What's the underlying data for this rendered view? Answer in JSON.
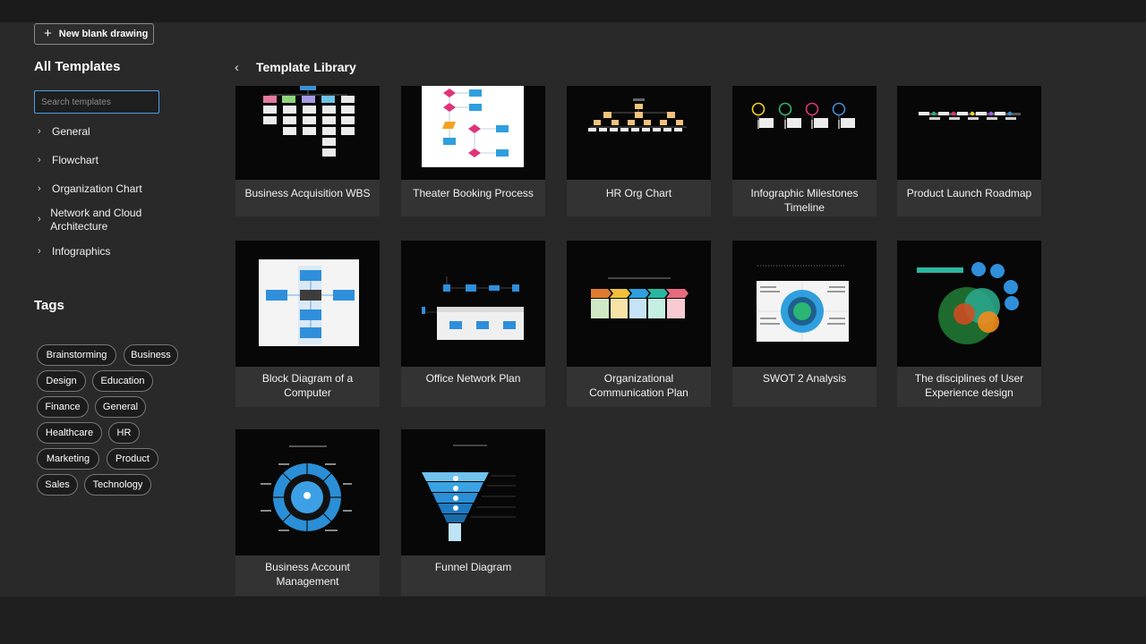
{
  "toolbar": {
    "new_blank_label": "New blank drawing"
  },
  "sidebar": {
    "title": "All Templates",
    "search_placeholder": "Search templates",
    "categories": [
      {
        "label": "General"
      },
      {
        "label": "Flowchart"
      },
      {
        "label": "Organization Chart"
      },
      {
        "label": "Network and Cloud Architecture"
      },
      {
        "label": "Infographics"
      }
    ],
    "tags_title": "Tags",
    "tags": [
      "Brainstorming",
      "Business",
      "Design",
      "Education",
      "Finance",
      "General",
      "Healthcare",
      "HR",
      "Marketing",
      "Product",
      "Sales",
      "Technology"
    ]
  },
  "library": {
    "title": "Template Library",
    "templates": [
      {
        "title": "Business Acquisition WBS"
      },
      {
        "title": "Theater Booking Process"
      },
      {
        "title": "HR Org Chart"
      },
      {
        "title": "Infographic Milestones Timeline"
      },
      {
        "title": "Product Launch Roadmap"
      },
      {
        "title": "Block Diagram of a Computer"
      },
      {
        "title": "Office Network Plan"
      },
      {
        "title": "Organizational Communication Plan"
      },
      {
        "title": "SWOT 2 Analysis"
      },
      {
        "title": "The disciplines of User Experience design"
      },
      {
        "title": "Business Account Management"
      },
      {
        "title": "Funnel Diagram"
      }
    ]
  },
  "colors": {
    "accent": "#4f9fe6",
    "background": "#292929",
    "card": "#333333"
  },
  "icons": {
    "plus": "plus-icon",
    "chevron": "chevron-right-icon",
    "back": "chevron-left-icon"
  }
}
